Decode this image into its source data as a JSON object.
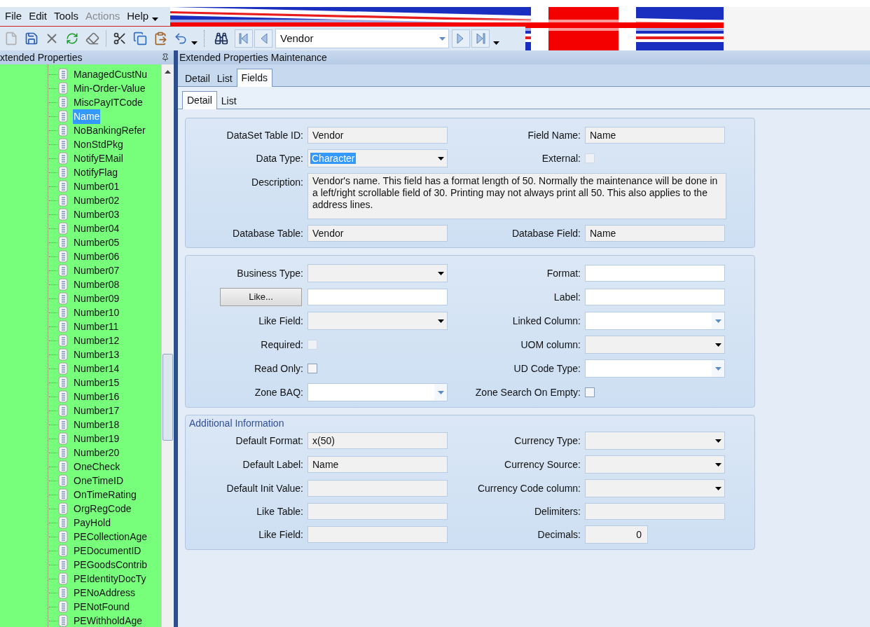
{
  "menu": [
    {
      "label": "File",
      "disabled": false
    },
    {
      "label": "Edit",
      "disabled": false
    },
    {
      "label": "Tools",
      "disabled": false
    },
    {
      "label": "Actions",
      "disabled": true
    },
    {
      "label": "Help",
      "disabled": false
    }
  ],
  "toolbar": {
    "navigator": {
      "value": "Vendor"
    }
  },
  "left_panel": {
    "title": "xtended Properties",
    "items": [
      {
        "label": "ManagedCustNu",
        "selected": false
      },
      {
        "label": "Min-Order-Value",
        "selected": false
      },
      {
        "label": "MiscPayITCode",
        "selected": false
      },
      {
        "label": "Name",
        "selected": true
      },
      {
        "label": "NoBankingRefer",
        "selected": false
      },
      {
        "label": "NonStdPkg",
        "selected": false
      },
      {
        "label": "NotifyEMail",
        "selected": false
      },
      {
        "label": "NotifyFlag",
        "selected": false
      },
      {
        "label": "Number01",
        "selected": false
      },
      {
        "label": "Number02",
        "selected": false
      },
      {
        "label": "Number03",
        "selected": false
      },
      {
        "label": "Number04",
        "selected": false
      },
      {
        "label": "Number05",
        "selected": false
      },
      {
        "label": "Number06",
        "selected": false
      },
      {
        "label": "Number07",
        "selected": false
      },
      {
        "label": "Number08",
        "selected": false
      },
      {
        "label": "Number09",
        "selected": false
      },
      {
        "label": "Number10",
        "selected": false
      },
      {
        "label": "Number11",
        "selected": false
      },
      {
        "label": "Number12",
        "selected": false
      },
      {
        "label": "Number13",
        "selected": false
      },
      {
        "label": "Number14",
        "selected": false
      },
      {
        "label": "Number15",
        "selected": false
      },
      {
        "label": "Number16",
        "selected": false
      },
      {
        "label": "Number17",
        "selected": false
      },
      {
        "label": "Number18",
        "selected": false
      },
      {
        "label": "Number19",
        "selected": false
      },
      {
        "label": "Number20",
        "selected": false
      },
      {
        "label": "OneCheck",
        "selected": false
      },
      {
        "label": "OneTimeID",
        "selected": false
      },
      {
        "label": "OnTimeRating",
        "selected": false
      },
      {
        "label": "OrgRegCode",
        "selected": false
      },
      {
        "label": "PayHold",
        "selected": false
      },
      {
        "label": "PECollectionAge",
        "selected": false
      },
      {
        "label": "PEDocumentID",
        "selected": false
      },
      {
        "label": "PEGoodsContrib",
        "selected": false
      },
      {
        "label": "PEIdentityDocTy",
        "selected": false
      },
      {
        "label": "PENoAddress",
        "selected": false
      },
      {
        "label": "PENotFound",
        "selected": false
      },
      {
        "label": "PEWithholdAge",
        "selected": false
      }
    ]
  },
  "main": {
    "title": "Extended Properties Maintenance",
    "tabs": [
      {
        "label": "Detail",
        "selected": false
      },
      {
        "label": "List",
        "selected": false
      },
      {
        "label": "Fields",
        "selected": true
      }
    ],
    "subtabs": [
      {
        "label": "Detail",
        "selected": true
      },
      {
        "label": "List",
        "selected": false
      }
    ],
    "panels": [
      {
        "rows": [
          {
            "kind": "pair",
            "left": {
              "label": "DataSet Table ID:",
              "kind": "readonly",
              "value": "Vendor"
            },
            "right": {
              "label": "Field Name:",
              "kind": "readonly",
              "value": "Name"
            }
          },
          {
            "kind": "pair",
            "left": {
              "label": "Data Type:",
              "kind": "combo",
              "value": "Character",
              "highlighted": true
            },
            "right": {
              "label": "External:",
              "kind": "check",
              "checked": false,
              "disabled": true
            }
          },
          {
            "kind": "memo",
            "label": "Description:",
            "value": "Vendor's name.  This field has a format length of 50. Normally the maintenance will be done in a left/right scrollable field of 30. Printing may not always print all 50. This also applies to the address lines."
          },
          {
            "kind": "pair",
            "left": {
              "label": "Database Table:",
              "kind": "readonly",
              "value": "Vendor"
            },
            "right": {
              "label": "Database Field:",
              "kind": "readonly",
              "value": "Name"
            }
          }
        ]
      },
      {
        "rows": [
          {
            "kind": "pair",
            "left": {
              "label": "Business Type:",
              "kind": "combo"
            },
            "right": {
              "label": "Format:",
              "kind": "input"
            }
          },
          {
            "kind": "pair",
            "left": {
              "button": "Like...",
              "kind": "button_input"
            },
            "right": {
              "label": "Label:",
              "kind": "input"
            }
          },
          {
            "kind": "pair",
            "left": {
              "label": "Like Field:",
              "kind": "combo"
            },
            "right": {
              "label": "Linked Column:",
              "kind": "search_combo"
            }
          },
          {
            "kind": "pair",
            "left": {
              "label": "Required:",
              "kind": "check",
              "checked": false,
              "disabled": true
            },
            "right": {
              "label": "UOM column:",
              "kind": "combo"
            }
          },
          {
            "kind": "pair",
            "left": {
              "label": "Read Only:",
              "kind": "check",
              "checked": false,
              "disabled": false
            },
            "right": {
              "label": "UD Code Type:",
              "kind": "search_combo"
            }
          },
          {
            "kind": "pair",
            "left": {
              "label": "Zone BAQ:",
              "kind": "search_combo"
            },
            "right": {
              "label": "Zone Search On Empty:",
              "kind": "check",
              "checked": false,
              "disabled": false
            }
          }
        ]
      },
      {
        "title": "Additional Information",
        "rows": [
          {
            "kind": "pair",
            "left": {
              "label": "Default Format:",
              "kind": "readonly",
              "value": "x(50)"
            },
            "right": {
              "label": "Currency Type:",
              "kind": "combo"
            }
          },
          {
            "kind": "pair",
            "left": {
              "label": "Default Label:",
              "kind": "readonly",
              "value": "Name"
            },
            "right": {
              "label": "Currency Source:",
              "kind": "combo"
            }
          },
          {
            "kind": "pair",
            "left": {
              "label": "Default Init Value:",
              "kind": "readonly"
            },
            "right": {
              "label": "Currency Code column:",
              "kind": "combo"
            }
          },
          {
            "kind": "pair",
            "left": {
              "label": "Like Table:",
              "kind": "readonly"
            },
            "right": {
              "label": "Delimiters:",
              "kind": "readonly"
            }
          },
          {
            "kind": "pair",
            "left": {
              "label": "Like Field:",
              "kind": "readonly"
            },
            "right": {
              "label": "Decimals:",
              "kind": "number",
              "value": "0"
            }
          }
        ]
      }
    ]
  }
}
